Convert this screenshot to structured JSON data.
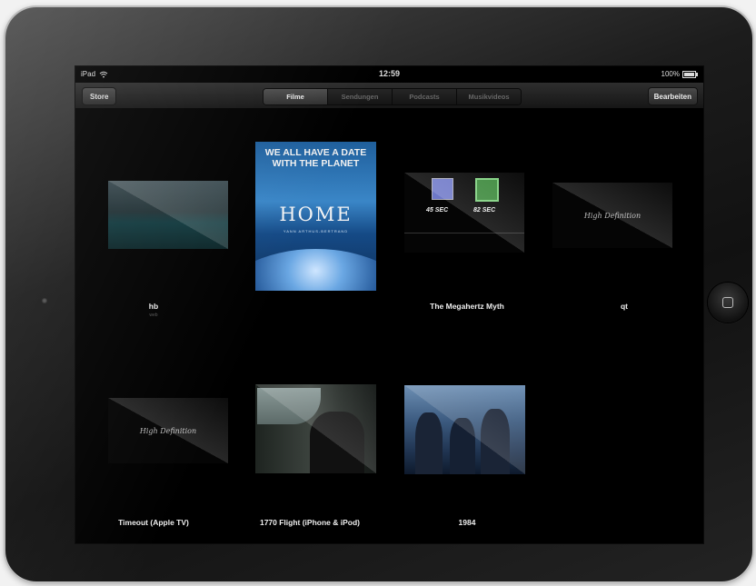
{
  "status_bar": {
    "device": "iPad",
    "time": "12:59",
    "battery": "100%"
  },
  "nav": {
    "store_label": "Store",
    "edit_label": "Bearbeiten",
    "tabs": [
      {
        "label": "Filme",
        "active": true
      },
      {
        "label": "Sendungen",
        "active": false
      },
      {
        "label": "Podcasts",
        "active": false
      },
      {
        "label": "Musikvideos",
        "active": false
      }
    ]
  },
  "videos": [
    {
      "title": "hb",
      "subtitle": "web"
    },
    {
      "title": "",
      "subtitle": "",
      "poster_tagline": "WE ALL HAVE A DATE WITH THE PLANET",
      "poster_title": "HOME",
      "poster_credit": "YANN ARTHUS-BERTRAND"
    },
    {
      "title": "The Megahertz Myth",
      "subtitle": "",
      "badge_left": "45 SEC",
      "badge_right": "82 SEC"
    },
    {
      "title": "qt",
      "subtitle": "",
      "thumb_text": "High Definition"
    },
    {
      "title": "Timeout (Apple TV)",
      "subtitle": "",
      "thumb_text": "High Definition"
    },
    {
      "title": "1770 Flight (iPhone & iPod)",
      "subtitle": ""
    },
    {
      "title": "1984",
      "subtitle": ""
    }
  ],
  "colors": {
    "screen_bg": "#000000",
    "bezel": "#1c1c1c",
    "tab_active_text": "#e8e8e8",
    "tab_inactive_text": "#666666"
  }
}
